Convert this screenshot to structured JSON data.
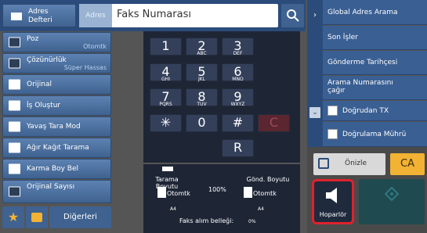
{
  "address_book": {
    "label": "Adres Defteri"
  },
  "address_tag": "Adres",
  "fax_input": {
    "placeholder": "Faks Numarası"
  },
  "left_menu": [
    {
      "label": "Poz",
      "sub": "Otomtk"
    },
    {
      "label": "Çözünürlük",
      "sub": "Süper Hassas"
    },
    {
      "label": "Orijinal",
      "sub": ""
    },
    {
      "label": "İş Oluştur",
      "sub": ""
    },
    {
      "label": "Yavaş Tara Mod",
      "sub": ""
    },
    {
      "label": "Ağır Kağıt Tarama",
      "sub": ""
    },
    {
      "label": "Karma Boy Bel",
      "sub": ""
    },
    {
      "label": "Orijinal Sayısı",
      "sub": ""
    }
  ],
  "others_label": "Diğerleri",
  "keypad": {
    "k1": "1",
    "k2": "2",
    "k2s": "ABC",
    "k3": "3",
    "k3s": "DEF",
    "k4": "4",
    "k4s": "GHI",
    "k5": "5",
    "k5s": "JKL",
    "k6": "6",
    "k6s": "MNO",
    "k7": "7",
    "k7s": "PQRS",
    "k8": "8",
    "k8s": "TUV",
    "k9": "9",
    "k9s": "WXYZ",
    "kstar": "✳",
    "k0": "0",
    "khash": "#",
    "kc": "C",
    "kr": "R"
  },
  "status": {
    "scan_size_label": "Tarama Boyutu",
    "scan_value": "Otomtk",
    "scan_paper": "A4",
    "ratio": "100%",
    "send_size_label": "Gönd. Boyutu",
    "send_value": "Otomtk",
    "send_paper": "A4",
    "memory_label": "Faks alım belleği:",
    "memory_value": "0%"
  },
  "right_menu": {
    "global": "Global Adres Arama",
    "recent": "Son İşler",
    "history": "Gönderme Tarihçesi",
    "recall": "Arama Numarasını çağır",
    "direct_tx": "Doğrudan TX",
    "verify_stamp": "Doğrulama Mührü"
  },
  "preview_label": "Önizle",
  "ca_label": "CA",
  "speaker_label": "Hoparlör",
  "colors": {
    "accent": "#f2b233",
    "highlight": "#e0212c",
    "panel": "#3a5f93"
  }
}
